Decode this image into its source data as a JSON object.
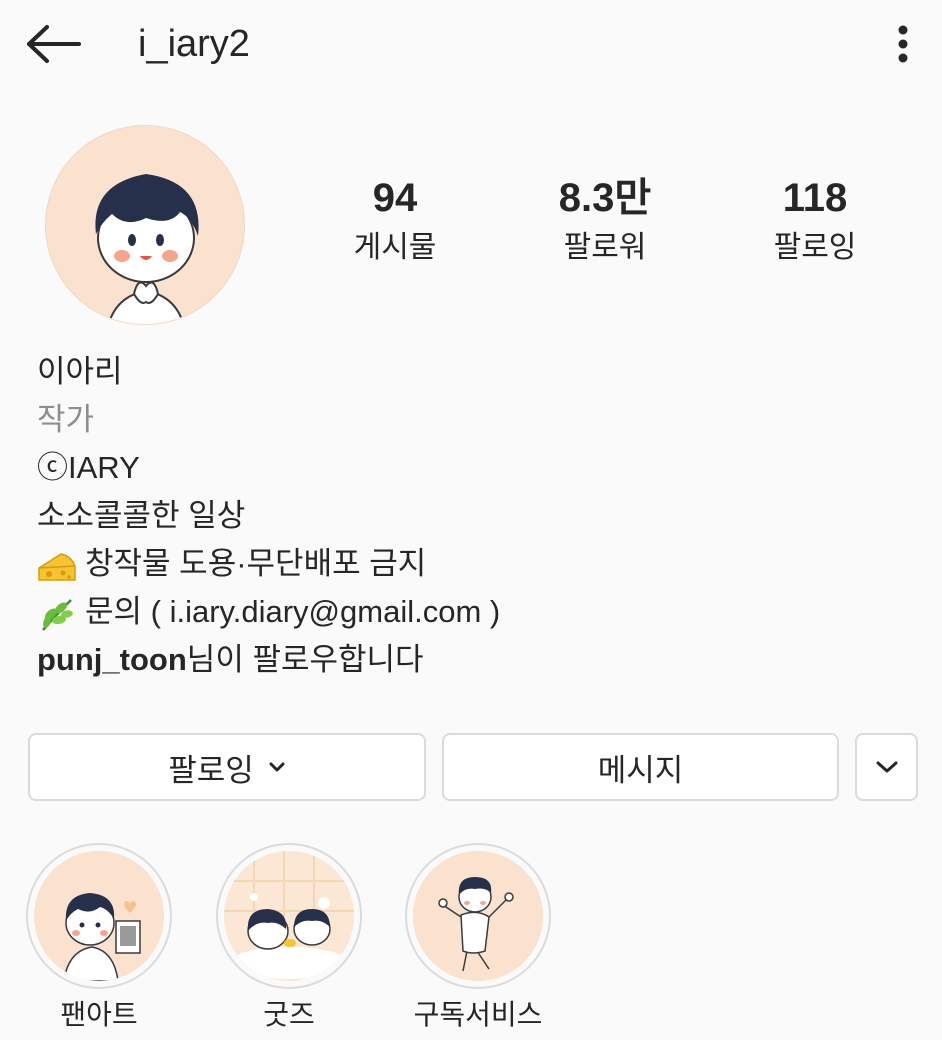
{
  "header": {
    "username": "i_iary2",
    "back_icon": "arrow-left-icon",
    "more_icon": "more-vertical-icon"
  },
  "profile": {
    "stats": [
      {
        "value": "94",
        "label": "게시물"
      },
      {
        "value": "8.3만",
        "label": "팔로워"
      },
      {
        "value": "118",
        "label": "팔로잉"
      }
    ]
  },
  "bio": {
    "name": "이아리",
    "category": "작가",
    "line1": "ⓒIARY",
    "line2": "소소콜콜한 일상",
    "line3": "창작물 도용·무단배포 금지",
    "line3_icon": "cheese-emoji-icon",
    "line4": "문의 ( i.iary.diary@gmail.com )",
    "line4_icon": "herb-emoji-icon",
    "followed_by_user": "punj_toon",
    "followed_by_suffix": "님이 팔로우합니다"
  },
  "actions": {
    "following_label": "팔로잉",
    "message_label": "메시지"
  },
  "highlights": [
    {
      "label": "팬아트"
    },
    {
      "label": "굿즈"
    },
    {
      "label": "구독서비스"
    }
  ],
  "colors": {
    "background": "#fafafa",
    "text": "#262626",
    "secondary_text": "#8e8e8e",
    "border": "#dbdbdb",
    "avatar_bg": "#fbe2cf"
  }
}
